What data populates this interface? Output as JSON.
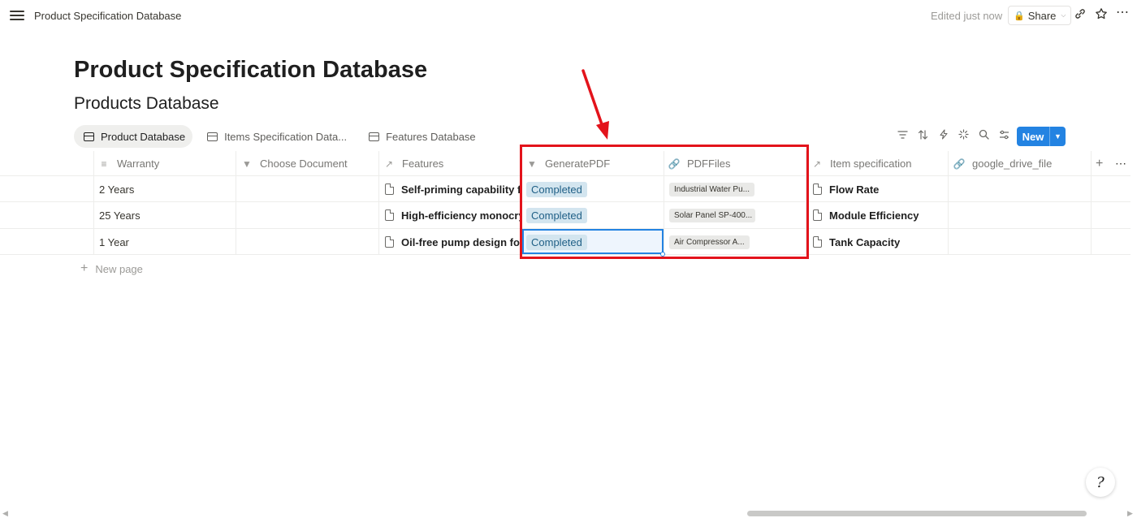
{
  "topbar": {
    "breadcrumb": "Product Specification Database",
    "edited": "Edited just now",
    "share_label": "Share"
  },
  "page": {
    "title": "Product Specification Database",
    "database_title": "Products Database"
  },
  "tabs": [
    {
      "label": "Product Database",
      "active": true
    },
    {
      "label": "Items Specification Data...",
      "active": false
    },
    {
      "label": "Features Database",
      "active": false
    }
  ],
  "toolbar": {
    "icons": [
      "filter-icon",
      "sort-icon",
      "automation-icon",
      "customize-icon",
      "search-icon",
      "settings-icon"
    ],
    "new_label": "New"
  },
  "table": {
    "columns": [
      {
        "label": "Warranty",
        "icon": "text-icon"
      },
      {
        "label": "Choose Document",
        "icon": "select-icon"
      },
      {
        "label": "Features",
        "icon": "relation-icon"
      },
      {
        "label": "GeneratePDF",
        "icon": "select-icon"
      },
      {
        "label": "PDFFiles",
        "icon": "link-icon"
      },
      {
        "label": "Item specification",
        "icon": "relation-icon"
      },
      {
        "label": "google_drive_file",
        "icon": "link-icon"
      }
    ],
    "rows": [
      {
        "warranty": "2 Years",
        "choose_document": "",
        "features": "Self-priming capability for",
        "generate_pdf": "Completed",
        "pdf_files": "Industrial Water Pu...",
        "item_specification": "Flow Rate",
        "google_drive_file": ""
      },
      {
        "warranty": "25 Years",
        "choose_document": "",
        "features": "High-efficiency monocryst",
        "generate_pdf": "Completed",
        "pdf_files": "Solar Panel SP-400...",
        "item_specification": "Module Efficiency",
        "google_drive_file": ""
      },
      {
        "warranty": "1 Year",
        "choose_document": "",
        "features": "Oil-free pump design for c",
        "generate_pdf": "Completed",
        "pdf_files": "Air Compressor A...",
        "item_specification": "Tank Capacity",
        "google_drive_file": ""
      }
    ],
    "new_page_label": "New page"
  },
  "help": {
    "glyph": "?"
  },
  "annotation": {
    "color": "#e3131b"
  },
  "colors": {
    "accent": "#2383e2",
    "status_bg": "#d3e5ef",
    "status_text": "#1f5f86"
  }
}
